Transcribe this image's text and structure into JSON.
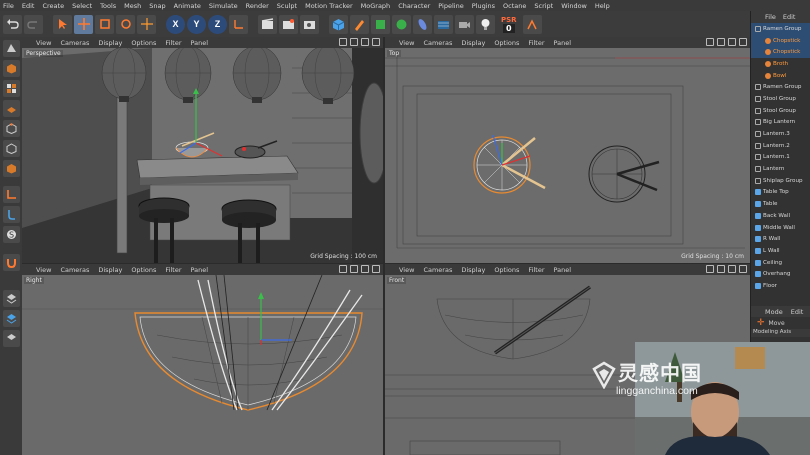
{
  "menu": [
    "File",
    "Edit",
    "Create",
    "Select",
    "Tools",
    "Mesh",
    "Snap",
    "Animate",
    "Simulate",
    "Render",
    "Sculpt",
    "Motion Tracker",
    "MoGraph",
    "Character",
    "Pipeline",
    "Plugins",
    "Octane",
    "Script",
    "Window",
    "Help"
  ],
  "toolbar": {
    "axis_x": "X",
    "axis_y": "Y",
    "axis_z": "Z",
    "psr_label": "PSR",
    "psr_value": "0",
    "icons": [
      "undo-icon",
      "redo-icon",
      "select-icon",
      "move-icon",
      "scale-icon",
      "rotate-icon",
      "live-select-icon",
      "axis-x-icon",
      "axis-y-icon",
      "axis-z-icon",
      "coordinate-system-icon",
      "render-view-icon",
      "render-picture-viewer-icon",
      "render-settings-icon",
      "cube-icon",
      "pen-icon",
      "subdivision-icon",
      "cloner-icon",
      "deformer-icon",
      "scene-icon",
      "camera-icon",
      "light-icon"
    ]
  },
  "viewports": [
    {
      "name": "Perspective",
      "menu": [
        "View",
        "Cameras",
        "Display",
        "Options",
        "Filter",
        "Panel"
      ],
      "grid": "Grid Spacing : 100 cm"
    },
    {
      "name": "Top",
      "menu": [
        "View",
        "Cameras",
        "Display",
        "Options",
        "Filter",
        "Panel"
      ],
      "grid": "Grid Spacing : 10 cm"
    },
    {
      "name": "Right",
      "menu": [
        "View",
        "Cameras",
        "Display",
        "Options",
        "Filter",
        "Panel"
      ],
      "grid": ""
    },
    {
      "name": "Front",
      "menu": [
        "View",
        "Cameras",
        "Display",
        "Options",
        "Filter",
        "Panel"
      ],
      "grid": ""
    }
  ],
  "object_manager": {
    "menu": [
      "File",
      "Edit"
    ],
    "items": [
      {
        "label": "Ramen Group",
        "type": "null",
        "selected": true,
        "child": false
      },
      {
        "label": "Chopstick",
        "type": "orange",
        "selected": true,
        "child": true
      },
      {
        "label": "Chopstick",
        "type": "orange",
        "selected": true,
        "child": true
      },
      {
        "label": "Broth",
        "type": "orange",
        "selected": false,
        "child": true
      },
      {
        "label": "Bowl",
        "type": "orange",
        "selected": false,
        "child": true
      },
      {
        "label": "Ramen Group",
        "type": "null",
        "selected": false,
        "child": false
      },
      {
        "label": "Stool Group",
        "type": "null",
        "selected": false,
        "child": false
      },
      {
        "label": "Stool Group",
        "type": "null",
        "selected": false,
        "child": false
      },
      {
        "label": "Big Lantern",
        "type": "null",
        "selected": false,
        "child": false
      },
      {
        "label": "Lantern.3",
        "type": "null",
        "selected": false,
        "child": false
      },
      {
        "label": "Lantern.2",
        "type": "null",
        "selected": false,
        "child": false
      },
      {
        "label": "Lantern.1",
        "type": "null",
        "selected": false,
        "child": false
      },
      {
        "label": "Lantern",
        "type": "null",
        "selected": false,
        "child": false
      },
      {
        "label": "Shiplap Group",
        "type": "null",
        "selected": false,
        "child": false
      },
      {
        "label": "Table Top",
        "type": "cube",
        "selected": false,
        "child": false
      },
      {
        "label": "Table",
        "type": "cube",
        "selected": false,
        "child": false
      },
      {
        "label": "Back Wall",
        "type": "cube",
        "selected": false,
        "child": false
      },
      {
        "label": "Middle Wall",
        "type": "cube",
        "selected": false,
        "child": false
      },
      {
        "label": "R Wall",
        "type": "cube",
        "selected": false,
        "child": false
      },
      {
        "label": "L Wall",
        "type": "cube",
        "selected": false,
        "child": false
      },
      {
        "label": "Ceiling",
        "type": "cube",
        "selected": false,
        "child": false
      },
      {
        "label": "Overhang",
        "type": "cube",
        "selected": false,
        "child": false
      },
      {
        "label": "Floor",
        "type": "cube",
        "selected": false,
        "child": false
      }
    ]
  },
  "attribute_manager": {
    "menu": [
      "Mode",
      "Edit"
    ],
    "tool": "Move",
    "tabs": "Modeling Axis"
  },
  "watermark": {
    "title": "灵感中国",
    "url": "lingganchina.com"
  },
  "colors": {
    "accent_selection": "#2e4d72",
    "selected_object": "#e5843a",
    "axis_button": "#2d4b7a",
    "psr": "#ff6a3d"
  }
}
